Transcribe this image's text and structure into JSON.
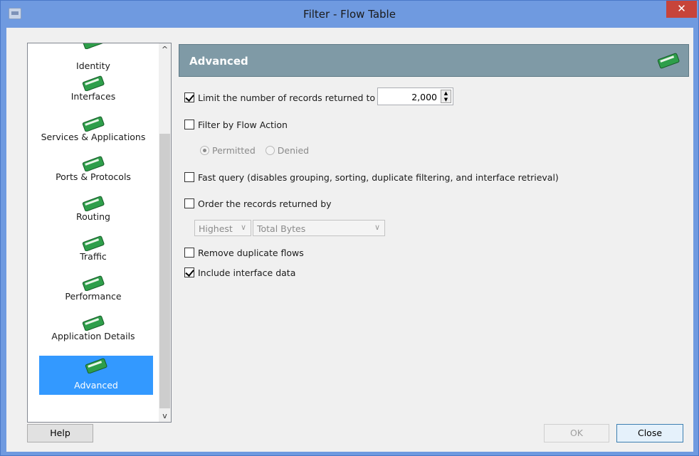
{
  "window": {
    "title": "Filter - Flow Table",
    "close_glyph": "✕"
  },
  "nav": {
    "items": [
      {
        "label": "Identity",
        "icon": "book-icon"
      },
      {
        "label": "Interfaces",
        "icon": "book-icon"
      },
      {
        "label": "Services & Applications",
        "icon": "book-icon"
      },
      {
        "label": "Ports & Protocols",
        "icon": "book-icon"
      },
      {
        "label": "Routing",
        "icon": "book-icon"
      },
      {
        "label": "Traffic",
        "icon": "book-icon"
      },
      {
        "label": "Performance",
        "icon": "book-icon"
      },
      {
        "label": "Application Details",
        "icon": "book-icon"
      },
      {
        "label": "Advanced",
        "icon": "book-icon",
        "selected": true
      }
    ],
    "scroll_up": "^",
    "scroll_down": "v"
  },
  "panel": {
    "title": "Advanced",
    "limit": {
      "label": "Limit the number of records returned to",
      "checked": true,
      "value": "2,000"
    },
    "flow_action": {
      "label": "Filter by Flow Action",
      "checked": false,
      "options": [
        {
          "label": "Permitted",
          "selected": true
        },
        {
          "label": "Denied",
          "selected": false
        }
      ]
    },
    "fast_query": {
      "label": "Fast query (disables grouping, sorting, duplicate filtering, and interface retrieval)",
      "checked": false
    },
    "order": {
      "label": "Order the records returned by",
      "checked": false,
      "direction": "Highest",
      "field": "Total Bytes"
    },
    "remove_duplicates": {
      "label": "Remove duplicate flows",
      "checked": false
    },
    "include_interface": {
      "label": "Include interface data",
      "checked": true
    }
  },
  "buttons": {
    "help": "Help",
    "ok": "OK",
    "close": "Close"
  },
  "colors": {
    "titlebar": "#6f9ae0",
    "close_button": "#c7443a",
    "header": "#7f9aa6",
    "selection": "#3399ff",
    "book_green": "#2e9e4a"
  }
}
